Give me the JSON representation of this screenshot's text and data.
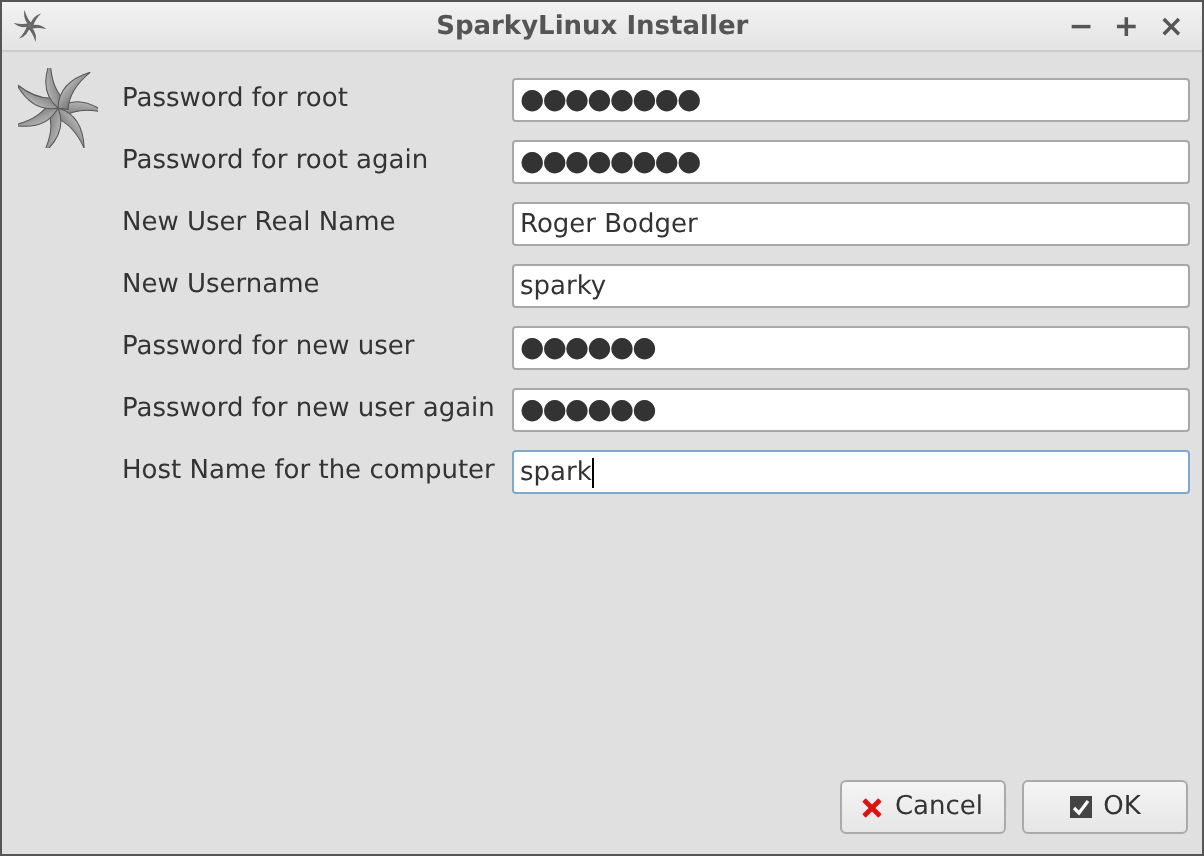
{
  "window": {
    "title": "SparkyLinux Installer",
    "controls": [
      "−",
      "+",
      "×"
    ]
  },
  "fields": [
    {
      "label": "Password for root",
      "kind": "password",
      "value": "●●●●●●●●",
      "focused": false
    },
    {
      "label": "Password for root again",
      "kind": "password",
      "value": "●●●●●●●●",
      "focused": false
    },
    {
      "label": "New User Real Name",
      "kind": "text",
      "value": "Roger Bodger",
      "focused": false
    },
    {
      "label": "New Username",
      "kind": "text",
      "value": "sparky",
      "focused": false
    },
    {
      "label": "Password for new user",
      "kind": "password",
      "value": "●●●●●●",
      "focused": false
    },
    {
      "label": "Password for new user again",
      "kind": "password",
      "value": "●●●●●●",
      "focused": false
    },
    {
      "label": "Host Name for the computer",
      "kind": "text",
      "value": "spark",
      "focused": true
    }
  ],
  "buttons": [
    {
      "label": "Cancel",
      "kind": "cancel"
    },
    {
      "label": "OK",
      "kind": "ok"
    }
  ]
}
